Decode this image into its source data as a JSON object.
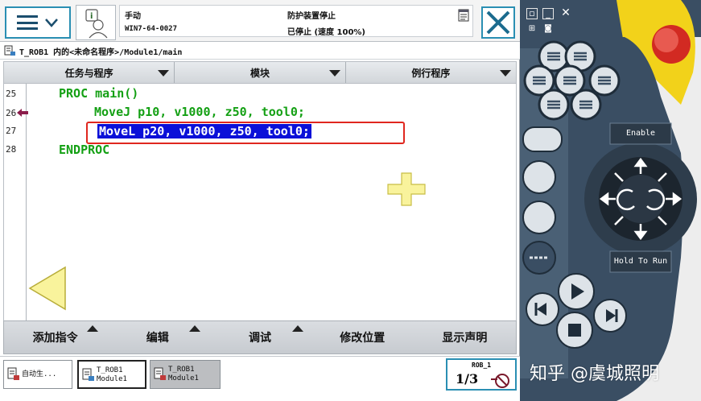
{
  "status": {
    "mode": "手动",
    "controller": "WIN7-64-0027",
    "guard_state": "防护装置停止",
    "run_state": "已停止 (速度 100%)"
  },
  "path": "T_ROB1 内的<未命名程序>/Module1/main",
  "tabs": [
    {
      "label": "任务与程序"
    },
    {
      "label": "模块"
    },
    {
      "label": "例行程序"
    }
  ],
  "editor": {
    "lines": [
      {
        "num": "25",
        "text": "PROC main()"
      },
      {
        "num": "26",
        "text": "MoveJ p10, v1000, z50, tool0;"
      },
      {
        "num": "27",
        "text": "MoveL p20, v1000, z50, tool0;"
      },
      {
        "num": "28",
        "text": "ENDPROC"
      }
    ],
    "code_color": "#14a014",
    "selection_color": "#0b10d8",
    "highlight_border_color": "#e0271f"
  },
  "commands": [
    {
      "label": "添加指令"
    },
    {
      "label": "编辑"
    },
    {
      "label": "调试"
    },
    {
      "label": "修改位置"
    },
    {
      "label": "显示声明"
    }
  ],
  "taskbar": {
    "auto": "自动生...",
    "rob1_title": "T_ROB1",
    "rob1_module": "Module1",
    "rob2_title": "T_ROB1",
    "rob2_module": "Module1",
    "quickset_label": "ROB_1",
    "ratio": "1/3"
  },
  "hardware": {
    "enable_label": "Enable",
    "hold_label": "Hold To Run",
    "panel_color": "#3a4e63",
    "emergency_color": "#e0271f",
    "guard_color": "#f2d21a"
  },
  "watermark": "知乎 @虞城照明",
  "icons": [
    "menu-icon",
    "chevron-down-icon",
    "user-icon",
    "document-icon",
    "close-icon",
    "program-icon",
    "line-arrow-icon",
    "plus-icon",
    "minus-icon",
    "left-arrow-icon",
    "joystick-icon",
    "play-icon",
    "stop-icon"
  ]
}
